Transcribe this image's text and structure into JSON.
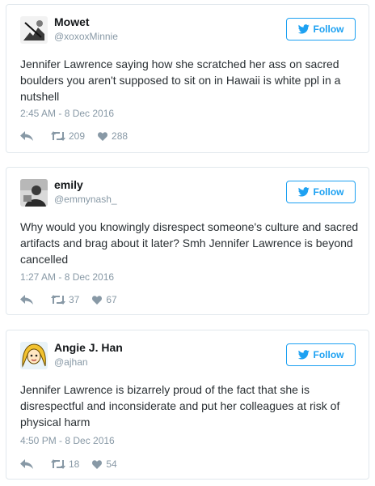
{
  "follow_label": "Follow",
  "colors": {
    "accent": "#1da1f2",
    "meta": "#8899a6",
    "text": "#292f33",
    "border": "#e1e8ed"
  },
  "icons": [
    "twitter-bird-icon",
    "reply-icon",
    "retweet-icon",
    "heart-icon"
  ],
  "tweets": [
    {
      "name": "Mowet",
      "handle": "@xoxoxMinnie",
      "text": "Jennifer Lawrence saying how she scratched her ass on sacred boulders you aren't supposed to sit on in Hawaii is white ppl in a nutshell",
      "time": "2:45 AM - 8 Dec 2016",
      "retweets": "209",
      "likes": "288"
    },
    {
      "name": "emily",
      "handle": "@emmynash_",
      "text": "Why would you knowingly disrespect someone's culture and sacred artifacts and brag about it later? Smh Jennifer Lawrence is beyond cancelled",
      "time": "1:27 AM - 8 Dec 2016",
      "retweets": "37",
      "likes": "67"
    },
    {
      "name": "Angie J. Han",
      "handle": "@ajhan",
      "text": "Jennifer Lawrence is bizarrely proud of the fact that she is disrespectful and inconsiderate and put her colleagues at risk of physical harm",
      "time": "4:50 PM - 8 Dec 2016",
      "retweets": "18",
      "likes": "54"
    }
  ]
}
